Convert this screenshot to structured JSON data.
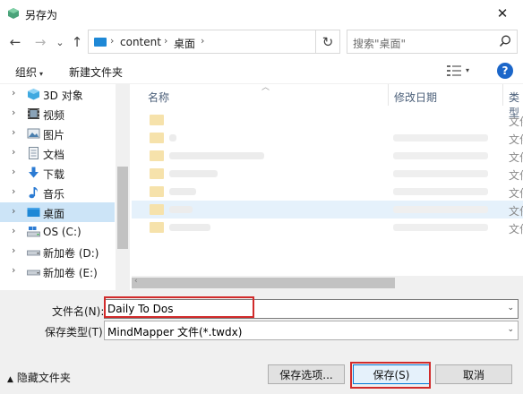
{
  "window": {
    "title": "另存为",
    "close_glyph": "✕"
  },
  "navigation": {
    "back_glyph": "←",
    "forward_glyph": "→",
    "recent_glyph": "⌄",
    "up_glyph": "↑",
    "refresh_glyph": "↻",
    "address": {
      "crumbs": [
        "content",
        "桌面"
      ],
      "separator_glyph": "›",
      "dropdown_glyph": "⌄"
    },
    "search": {
      "placeholder": "搜索\"桌面\""
    }
  },
  "toolbar": {
    "organize_label": "组织",
    "organize_caret": "▾",
    "new_folder_label": "新建文件夹",
    "view_caret": "▾",
    "help_glyph": "?"
  },
  "sidebar": {
    "chevron_glyph": "›",
    "items": [
      {
        "label": "3D 对象",
        "icon": "3d-objects-icon",
        "selected": false
      },
      {
        "label": "视频",
        "icon": "videos-icon",
        "selected": false
      },
      {
        "label": "图片",
        "icon": "pictures-icon",
        "selected": false
      },
      {
        "label": "文档",
        "icon": "documents-icon",
        "selected": false
      },
      {
        "label": "下载",
        "icon": "downloads-icon",
        "selected": false
      },
      {
        "label": "音乐",
        "icon": "music-icon",
        "selected": false
      },
      {
        "label": "桌面",
        "icon": "desktop-icon",
        "selected": true
      },
      {
        "label": "OS (C:)",
        "icon": "os-drive-icon",
        "selected": false
      },
      {
        "label": "新加卷 (D:)",
        "icon": "drive-icon",
        "selected": false
      },
      {
        "label": "新加卷 (E:)",
        "icon": "drive-icon",
        "selected": false
      }
    ]
  },
  "file_list": {
    "columns": {
      "name": "名称",
      "modified": "修改日期",
      "type": "类型"
    },
    "sort_glyph": "︿",
    "rows": [
      {
        "type": "文件",
        "highlight": false
      },
      {
        "type": "文件",
        "highlight": false
      },
      {
        "type": "文件",
        "highlight": false
      },
      {
        "type": "文件",
        "highlight": false
      },
      {
        "type": "文件",
        "highlight": false
      },
      {
        "type": "文件",
        "highlight": true
      },
      {
        "type": "文件",
        "highlight": false
      }
    ],
    "scroll_left_glyph": "‹"
  },
  "form": {
    "filename_label": "文件名(N):",
    "filename_value": "Daily To Dos",
    "filetype_label": "保存类型(T):",
    "filetype_value": "MindMapper 文件(*.twdx)",
    "dropdown_glyph": "⌄"
  },
  "footer": {
    "hide_folders_label": "隐藏文件夹",
    "hide_folders_caret": "▲",
    "options_button": "保存选项...",
    "save_button": "保存(S)",
    "cancel_button": "取消"
  },
  "colors": {
    "accent": "#1b66c9",
    "selection": "#cce4f7",
    "highlight_outline": "#d12b2b",
    "primary_button_border": "#0078d7"
  }
}
